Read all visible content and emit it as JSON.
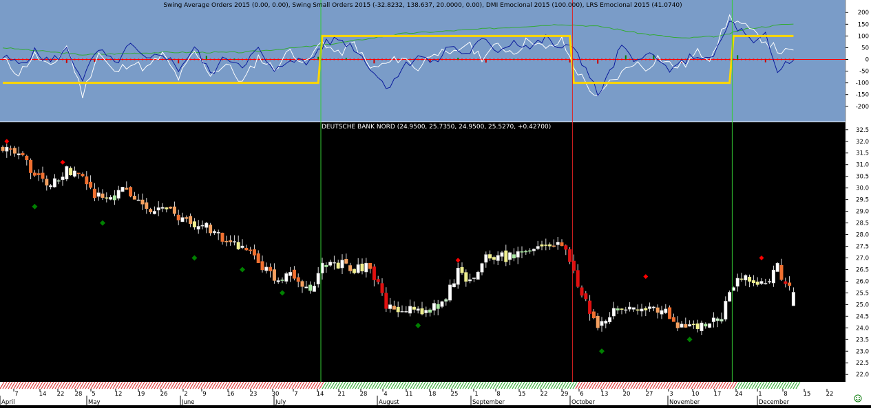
{
  "upper_panel": {
    "title": "Swing Average Orders 2015 (0.00, 0.00), Swing Small Orders 2015 (-32.8232, 138.637, 20.0000, 0.00), DMI Emocional 2015 (100.000), LRS Emocional 2015 (41.0740)",
    "yticks": [
      "200",
      "150",
      "100",
      "50",
      "0",
      "-50",
      "-100",
      "-150",
      "-200"
    ],
    "colors": {
      "background": "#7a9cc8",
      "zero_line": "#ff0000",
      "regime": "#ffd700",
      "dmi": "#0a1a9c",
      "lrs": "#ffffff",
      "avg": "#33aa33"
    }
  },
  "lower_panel": {
    "title": "DEUTSCHE BANK NORD (24.9500, 25.7350, 24.9500, 25.5270, +0.42700)",
    "yticks": [
      "32.5",
      "32.0",
      "31.5",
      "31.0",
      "30.5",
      "30.0",
      "29.5",
      "29.0",
      "28.5",
      "28.0",
      "27.5",
      "27.0",
      "26.5",
      "26.0",
      "25.5",
      "25.0",
      "24.5",
      "24.0",
      "23.5",
      "23.0",
      "22.5",
      "22.0"
    ],
    "colors": {
      "background": "#000000",
      "up": "#ffffff",
      "signal_long": "#33cc33",
      "signal_short": "#dd2222",
      "diamond_up": "#008000",
      "diamond_down": "#ff0000"
    }
  },
  "x_axis": {
    "day_labels": [
      "7",
      "14",
      "22",
      "28",
      "5",
      "12",
      "19",
      "26",
      "2",
      "9",
      "16",
      "23",
      "30",
      "7",
      "14",
      "21",
      "28",
      "4",
      "11",
      "18",
      "25",
      "1",
      "8",
      "15",
      "22",
      "29",
      "6",
      "13",
      "20",
      "27",
      "3",
      "10",
      "17",
      "24",
      "1",
      "8",
      "15",
      "22"
    ],
    "month_labels": [
      "April",
      "May",
      "June",
      "July",
      "August",
      "September",
      "October",
      "November",
      "December"
    ]
  },
  "status_icon": "smiley-icon",
  "chart_data": {
    "type": "candlestick",
    "title": "DEUTSCHE BANK NORD (24.9500, 25.7350, 24.9500, 25.5270, +0.42700)",
    "price_ylim": [
      21.8,
      32.7
    ],
    "indicator_ylim": [
      -230,
      230
    ],
    "last_bar": {
      "open": 24.95,
      "high": 25.735,
      "low": 24.95,
      "close": 25.527,
      "change": 0.427
    },
    "regime_levels": {
      "long": 100,
      "short": -100
    },
    "signals": [
      {
        "x": 80,
        "type": "long"
      },
      {
        "x": 143,
        "type": "short"
      },
      {
        "x": 183,
        "type": "long"
      }
    ],
    "price_anchors": [
      [
        0,
        31.8
      ],
      [
        3,
        31.4
      ],
      [
        6,
        31.1
      ],
      [
        9,
        30.4
      ],
      [
        12,
        30.0
      ],
      [
        15,
        30.7
      ],
      [
        18,
        30.8
      ],
      [
        21,
        30.2
      ],
      [
        24,
        29.6
      ],
      [
        27,
        29.6
      ],
      [
        30,
        29.9
      ],
      [
        33,
        29.5
      ],
      [
        36,
        29.2
      ],
      [
        39,
        29.0
      ],
      [
        42,
        29.0
      ],
      [
        45,
        28.6
      ],
      [
        48,
        28.3
      ],
      [
        51,
        28.4
      ],
      [
        54,
        27.9
      ],
      [
        57,
        27.5
      ],
      [
        60,
        27.6
      ],
      [
        63,
        27.0
      ],
      [
        66,
        26.4
      ],
      [
        69,
        26.0
      ],
      [
        72,
        26.5
      ],
      [
        75,
        25.7
      ],
      [
        78,
        25.8
      ],
      [
        80,
        26.6
      ],
      [
        83,
        26.8
      ],
      [
        86,
        26.7
      ],
      [
        89,
        26.5
      ],
      [
        92,
        26.7
      ],
      [
        94,
        25.8
      ],
      [
        96,
        24.9
      ],
      [
        99,
        24.6
      ],
      [
        102,
        24.8
      ],
      [
        105,
        24.7
      ],
      [
        108,
        24.9
      ],
      [
        111,
        25.3
      ],
      [
        114,
        26.4
      ],
      [
        117,
        26.0
      ],
      [
        120,
        26.9
      ],
      [
        123,
        27.1
      ],
      [
        126,
        27.0
      ],
      [
        129,
        27.1
      ],
      [
        132,
        27.5
      ],
      [
        135,
        27.6
      ],
      [
        138,
        27.6
      ],
      [
        141,
        27.3
      ],
      [
        143,
        26.5
      ],
      [
        145,
        25.4
      ],
      [
        147,
        24.7
      ],
      [
        149,
        23.8
      ],
      [
        151,
        24.4
      ],
      [
        153,
        24.8
      ],
      [
        156,
        25.0
      ],
      [
        159,
        24.6
      ],
      [
        162,
        24.8
      ],
      [
        165,
        24.8
      ],
      [
        168,
        24.3
      ],
      [
        171,
        24.0
      ],
      [
        174,
        24.0
      ],
      [
        177,
        24.1
      ],
      [
        180,
        24.5
      ],
      [
        182,
        25.7
      ],
      [
        184,
        26.1
      ],
      [
        186,
        26.2
      ],
      [
        188,
        25.8
      ],
      [
        190,
        26.2
      ],
      [
        192,
        26.0
      ],
      [
        194,
        26.6
      ],
      [
        196,
        25.8
      ],
      [
        198,
        25.5
      ]
    ],
    "dmi_anchors": [
      [
        0,
        10
      ],
      [
        4,
        -20
      ],
      [
        8,
        30
      ],
      [
        12,
        -10
      ],
      [
        16,
        40
      ],
      [
        20,
        -80
      ],
      [
        24,
        40
      ],
      [
        28,
        -20
      ],
      [
        32,
        60
      ],
      [
        36,
        -10
      ],
      [
        40,
        30
      ],
      [
        44,
        -40
      ],
      [
        48,
        50
      ],
      [
        52,
        -60
      ],
      [
        56,
        10
      ],
      [
        60,
        -20
      ],
      [
        64,
        40
      ],
      [
        68,
        -60
      ],
      [
        72,
        10
      ],
      [
        76,
        -20
      ],
      [
        80,
        60
      ],
      [
        84,
        90
      ],
      [
        88,
        50
      ],
      [
        92,
        -30
      ],
      [
        96,
        -120
      ],
      [
        100,
        -40
      ],
      [
        104,
        20
      ],
      [
        108,
        -20
      ],
      [
        112,
        60
      ],
      [
        116,
        20
      ],
      [
        120,
        80
      ],
      [
        124,
        40
      ],
      [
        128,
        80
      ],
      [
        132,
        50
      ],
      [
        136,
        90
      ],
      [
        140,
        40
      ],
      [
        143,
        60
      ],
      [
        146,
        -40
      ],
      [
        149,
        -150
      ],
      [
        152,
        -60
      ],
      [
        155,
        60
      ],
      [
        158,
        -20
      ],
      [
        161,
        40
      ],
      [
        164,
        -10
      ],
      [
        168,
        -50
      ],
      [
        171,
        0
      ],
      [
        174,
        20
      ],
      [
        177,
        -10
      ],
      [
        180,
        80
      ],
      [
        182,
        160
      ],
      [
        185,
        120
      ],
      [
        188,
        60
      ],
      [
        191,
        100
      ],
      [
        194,
        -60
      ],
      [
        196,
        -10
      ]
    ],
    "lrs_anchors": [
      [
        0,
        0
      ],
      [
        4,
        -60
      ],
      [
        8,
        20
      ],
      [
        12,
        -40
      ],
      [
        16,
        60
      ],
      [
        20,
        -150
      ],
      [
        24,
        30
      ],
      [
        28,
        -60
      ],
      [
        32,
        -10
      ],
      [
        36,
        -40
      ],
      [
        40,
        20
      ],
      [
        44,
        -80
      ],
      [
        48,
        30
      ],
      [
        52,
        -60
      ],
      [
        56,
        -20
      ],
      [
        60,
        -100
      ],
      [
        64,
        10
      ],
      [
        68,
        -40
      ],
      [
        72,
        40
      ],
      [
        76,
        -20
      ],
      [
        80,
        80
      ],
      [
        84,
        20
      ],
      [
        88,
        70
      ],
      [
        92,
        -40
      ],
      [
        96,
        -20
      ],
      [
        100,
        10
      ],
      [
        104,
        -40
      ],
      [
        108,
        40
      ],
      [
        112,
        10
      ],
      [
        116,
        70
      ],
      [
        120,
        10
      ],
      [
        124,
        60
      ],
      [
        128,
        30
      ],
      [
        132,
        90
      ],
      [
        136,
        40
      ],
      [
        140,
        80
      ],
      [
        143,
        -30
      ],
      [
        146,
        -100
      ],
      [
        149,
        -170
      ],
      [
        152,
        -100
      ],
      [
        155,
        -60
      ],
      [
        158,
        -10
      ],
      [
        161,
        -40
      ],
      [
        164,
        10
      ],
      [
        168,
        -30
      ],
      [
        171,
        -20
      ],
      [
        174,
        30
      ],
      [
        177,
        10
      ],
      [
        180,
        110
      ],
      [
        182,
        180
      ],
      [
        185,
        150
      ],
      [
        188,
        110
      ],
      [
        191,
        80
      ],
      [
        194,
        40
      ],
      [
        196,
        30
      ]
    ],
    "avg_anchors": [
      [
        0,
        50
      ],
      [
        20,
        20
      ],
      [
        40,
        30
      ],
      [
        60,
        30
      ],
      [
        80,
        60
      ],
      [
        100,
        110
      ],
      [
        120,
        130
      ],
      [
        140,
        150
      ],
      [
        150,
        140
      ],
      [
        160,
        110
      ],
      [
        170,
        90
      ],
      [
        180,
        100
      ],
      [
        186,
        130
      ],
      [
        196,
        150
      ]
    ]
  }
}
